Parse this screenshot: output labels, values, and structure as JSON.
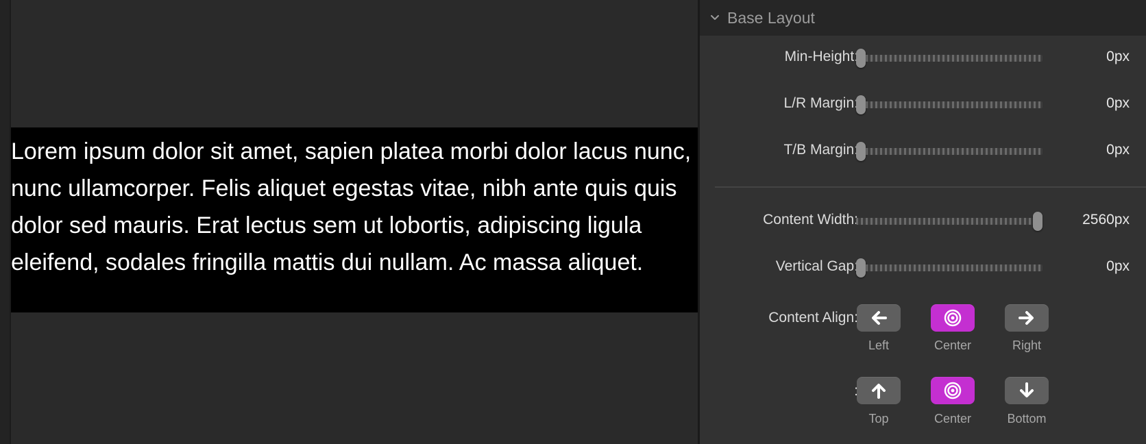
{
  "preview": {
    "text": "Lorem ipsum dolor sit amet, sapien platea morbi dolor lacus nunc, nunc ullamcorper. Felis aliquet egestas vitae, nibh ante quis quis dolor sed mauris. Erat lectus sem ut lobortis, adipiscing ligula eleifend, sodales fringilla mattis dui nullam. Ac massa aliquet."
  },
  "panel": {
    "title": "Base Layout",
    "sliders": [
      {
        "label": "Min-Height:",
        "value": "0px",
        "level": 0
      },
      {
        "label": "L/R Margin:",
        "value": "0px",
        "level": 0
      },
      {
        "label": "T/B Margin:",
        "value": "0px",
        "level": 0
      },
      {
        "label": "Content Width:",
        "value": "2560px",
        "level": 1
      },
      {
        "label": "Vertical Gap:",
        "value": "0px",
        "level": 0
      }
    ],
    "content_align": {
      "label": "Content Align:",
      "options": [
        {
          "label": "Left",
          "icon": "arrow-left-icon",
          "active": false
        },
        {
          "label": "Center",
          "icon": "target-icon",
          "active": true
        },
        {
          "label": "Right",
          "icon": "arrow-right-icon",
          "active": false
        }
      ]
    },
    "vertical_align": {
      "label": ":",
      "options": [
        {
          "label": "Top",
          "icon": "arrow-up-icon",
          "active": false
        },
        {
          "label": "Center",
          "icon": "target-icon",
          "active": true
        },
        {
          "label": "Bottom",
          "icon": "arrow-down-icon",
          "active": false
        }
      ]
    },
    "colors": {
      "accent": "#c42fd1",
      "button": "#5f5f5f",
      "panel": "#323232"
    }
  }
}
